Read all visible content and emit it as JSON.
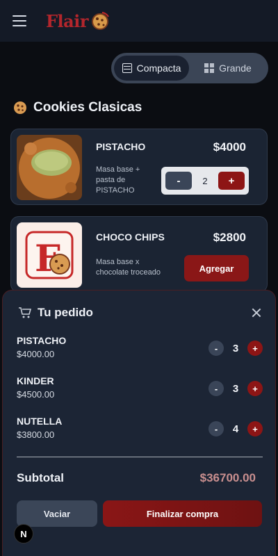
{
  "header": {
    "logo_text": "Flair"
  },
  "view_toggle": {
    "compact_label": "Compacta",
    "large_label": "Grande",
    "active": "compact"
  },
  "section": {
    "title": "Cookies Clasicas"
  },
  "products": [
    {
      "name": "PISTACHO",
      "price": "$4000",
      "desc_lines": [
        "Masa base +",
        "pasta de",
        "PISTACHO"
      ],
      "qty": "2"
    },
    {
      "name": "CHOCO CHIPS",
      "price": "$2800",
      "desc_lines": [
        "Masa base x",
        "chocolate troceado"
      ],
      "add_label": "Agregar"
    }
  ],
  "order": {
    "title": "Tu pedido",
    "items": [
      {
        "name": "PISTACHO",
        "price": "$4000.00",
        "qty": "3"
      },
      {
        "name": "KINDER",
        "price": "$4500.00",
        "qty": "3"
      },
      {
        "name": "NUTELLA",
        "price": "$3800.00",
        "qty": "4"
      }
    ],
    "subtotal_label": "Subtotal",
    "subtotal_value": "$36700.00",
    "clear_label": "Vaciar",
    "checkout_label": "Finalizar compra"
  },
  "badge": {
    "label": "N"
  },
  "colors": {
    "accent": "#8d1515",
    "panel": "#1c2535",
    "card": "#1b2433"
  }
}
